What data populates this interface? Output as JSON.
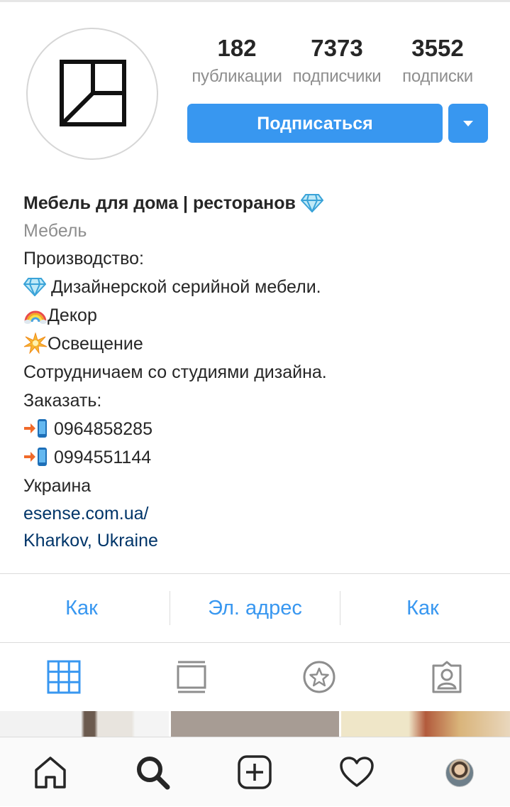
{
  "profile": {
    "stats": [
      {
        "value": "182",
        "label": "публикации"
      },
      {
        "value": "7373",
        "label": "подписчики"
      },
      {
        "value": "3552",
        "label": "подписки"
      }
    ],
    "follow_label": "Подписаться",
    "avatar_icon": "brand-logo-square-icon"
  },
  "bio": {
    "name": "Мебель для дома | ресторанов",
    "category": "Мебель",
    "lines": [
      "Производство:",
      "Дизайнерской серийной мебели.",
      "Декор",
      "Освещение",
      "Сотрудничаем со студиями дизайна.",
      "Заказать:",
      "0964858285",
      "0994551144",
      "Украина"
    ],
    "website": "esense.com.ua/",
    "location": "Kharkov, Ukraine"
  },
  "actions": [
    "Как",
    "Эл. адрес",
    "Как"
  ],
  "tabs": [
    "grid-icon",
    "feed-icon",
    "saved-star-icon",
    "tagged-person-icon"
  ],
  "bottom_nav": [
    "home-icon",
    "search-icon",
    "add-post-icon",
    "heart-icon",
    "profile-avatar"
  ],
  "colors": {
    "accent": "#3897f0",
    "link": "#003569",
    "muted": "#8e8e8e",
    "text": "#262626"
  }
}
